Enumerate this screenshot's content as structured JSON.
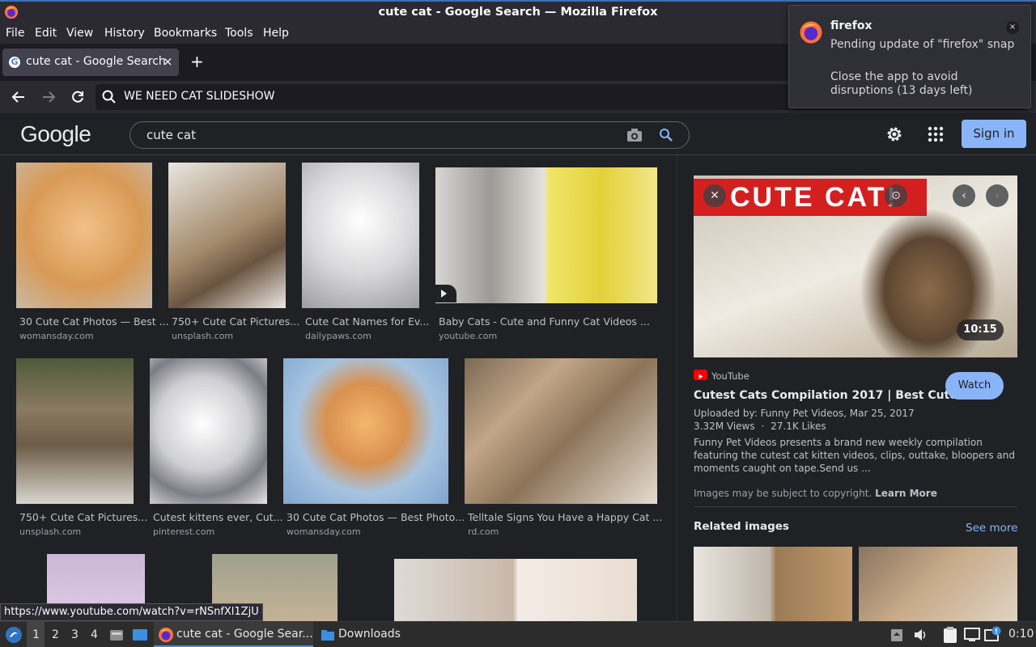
{
  "window": {
    "title": "cute cat - Google Search — Mozilla Firefox"
  },
  "menu": [
    "File",
    "Edit",
    "View",
    "History",
    "Bookmarks",
    "Tools",
    "Help"
  ],
  "tab": {
    "label": "cute cat - Google Search",
    "close": "×",
    "new": "+"
  },
  "urlbar": {
    "value": "WE NEED CAT SLIDESHOW"
  },
  "google": {
    "logo": "Google",
    "query": "cute cat",
    "signin": "Sign in"
  },
  "results": [
    {
      "title": "30 Cute Cat Photos — Best ...",
      "source": "womansday.com"
    },
    {
      "title": "750+ Cute Cat Pictures...",
      "source": "unsplash.com"
    },
    {
      "title": "Cute Cat Names for Ev...",
      "source": "dailypaws.com"
    },
    {
      "title": "Baby Cats - Cute and Funny Cat Videos ...",
      "source": "youtube.com"
    },
    {
      "title": "750+ Cute Cat Pictures...",
      "source": "unsplash.com"
    },
    {
      "title": "Cutest kittens ever, Cut...",
      "source": "pinterest.com"
    },
    {
      "title": "30 Cute Cat Photos — Best Photo...",
      "source": "womansday.com"
    },
    {
      "title": "Telltale Signs You Have a Happy Cat ...",
      "source": "rd.com"
    }
  ],
  "panel": {
    "hero_text": "CUTE CAT!",
    "duration": "10:15",
    "site": "YouTube",
    "title": "Cutest Cats Compilation 2017 | Best Cute ...",
    "watch": "Watch",
    "uploaded": "Uploaded by: Funny Pet Videos, Mar 25, 2017",
    "views": "3.32M Views",
    "dot": "·",
    "likes": "27.1K Likes",
    "description": "Funny Pet Videos presents a brand new weekly compilation featuring the cutest cat kitten videos, clips, outtake, bloopers and moments caught on tape.Send us ...",
    "copyright": "Images may be subject to copyright.",
    "learn_more": "Learn More",
    "related": "Related images",
    "see_more": "See more"
  },
  "notification": {
    "app": "firefox",
    "line1": "Pending update of \"firefox\" snap",
    "line2": "Close the app to avoid disruptions (13 days left)",
    "close": "×"
  },
  "status_url": "https://www.youtube.com/watch?v=rNSnfXl1ZjU",
  "taskbar": {
    "workspaces": [
      "1",
      "2",
      "3",
      "4"
    ],
    "active_window": "cute cat - Google Sear...",
    "downloads": "Downloads",
    "clock": "0:10"
  },
  "colors": {
    "accent": "#8ab4f8",
    "background": "#202124",
    "youtube_red": "#ff0000"
  }
}
